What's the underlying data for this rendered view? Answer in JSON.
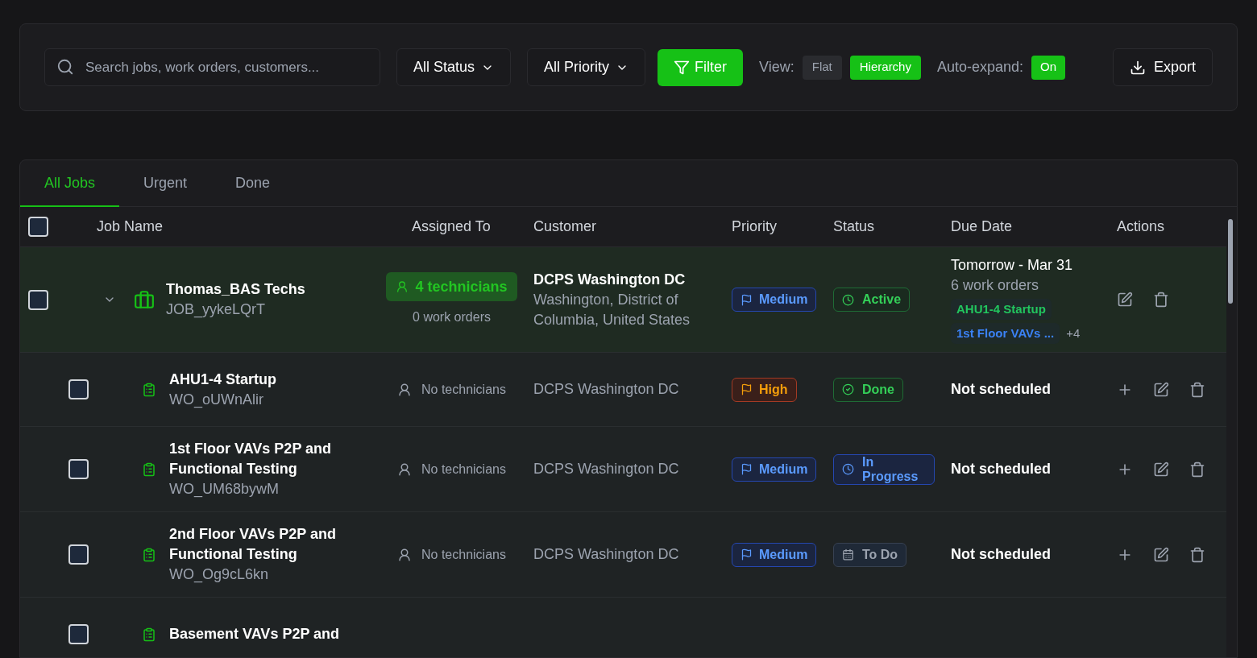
{
  "toolbar": {
    "search": {
      "placeholder": "Search jobs, work orders, customers..."
    },
    "dropdowns": [
      {
        "label": "All Status"
      },
      {
        "label": "All Priority"
      }
    ],
    "filter_button": "Filter",
    "view": {
      "label": "View:",
      "options": [
        {
          "label": "Flat",
          "selected": false
        },
        {
          "label": "Hierarchy",
          "selected": true
        }
      ]
    },
    "auto_expand": {
      "label": "Auto-expand:",
      "on": true,
      "value": "On"
    },
    "export_button": "Export"
  },
  "tabs": [
    {
      "label": "All Jobs",
      "selected": true
    },
    {
      "label": "Urgent",
      "selected": false
    },
    {
      "label": "Done",
      "selected": false
    }
  ],
  "table": {
    "select_all": {
      "checked": false
    },
    "columns": [
      "Job Name",
      "Assigned To",
      "Customer",
      "Priority",
      "Status",
      "Due Date",
      "Actions"
    ],
    "rows": [
      {
        "kind": "job",
        "checked": false,
        "expanded": true,
        "name": "Thomas_BAS Techs",
        "code": "JOB_yykeLQrT",
        "assigned": {
          "kind": "team",
          "label": "4 technicians",
          "note": "0 work orders"
        },
        "customer": {
          "name": "DCPS Washington DC",
          "address": "Washington, District of Columbia, United States"
        },
        "priority": {
          "kind": "medium",
          "label": "Medium"
        },
        "status": {
          "kind": "active",
          "label": "Active"
        },
        "due": {
          "label": "Tomorrow - Mar 31",
          "note": "6 work orders",
          "tags": [
            {
              "label": "AHU1-4 Startup",
              "color": "#22c55e"
            },
            {
              "label": "1st Floor VAVs ...",
              "color": "#3b82f6"
            }
          ],
          "more": "+4"
        },
        "actions": [
          {
            "kind": "edit"
          },
          {
            "kind": "delete"
          }
        ],
        "children": [
          {
            "kind": "work_order",
            "checked": false,
            "name": "AHU1-4 Startup",
            "code": "WO_oUWnAlir",
            "assigned": {
              "kind": "none",
              "label": "No technicians"
            },
            "customer": {
              "name": "DCPS Washington DC"
            },
            "priority": {
              "kind": "high",
              "label": "High"
            },
            "status": {
              "kind": "done",
              "label": "Done"
            },
            "due": {
              "label": "Not scheduled"
            },
            "actions": [
              {
                "kind": "add"
              },
              {
                "kind": "edit"
              },
              {
                "kind": "delete"
              }
            ]
          },
          {
            "kind": "work_order",
            "checked": false,
            "name": "1st Floor VAVs P2P and Functional Testing",
            "code": "WO_UM68bywM",
            "assigned": {
              "kind": "none",
              "label": "No technicians"
            },
            "customer": {
              "name": "DCPS Washington DC"
            },
            "priority": {
              "kind": "medium",
              "label": "Medium"
            },
            "status": {
              "kind": "in_progress",
              "label": "In Progress"
            },
            "due": {
              "label": "Not scheduled"
            },
            "actions": [
              {
                "kind": "add"
              },
              {
                "kind": "edit"
              },
              {
                "kind": "delete"
              }
            ]
          },
          {
            "kind": "work_order",
            "checked": false,
            "name": "2nd Floor VAVs P2P and Functional Testing",
            "code": "WO_Og9cL6kn",
            "assigned": {
              "kind": "none",
              "label": "No technicians"
            },
            "customer": {
              "name": "DCPS Washington DC"
            },
            "priority": {
              "kind": "medium",
              "label": "Medium"
            },
            "status": {
              "kind": "todo",
              "label": "To Do"
            },
            "due": {
              "label": "Not scheduled"
            },
            "actions": [
              {
                "kind": "add"
              },
              {
                "kind": "edit"
              },
              {
                "kind": "delete"
              }
            ]
          },
          {
            "kind": "work_order",
            "checked": false,
            "name": "Basement VAVs P2P and"
          }
        ]
      }
    ]
  }
}
